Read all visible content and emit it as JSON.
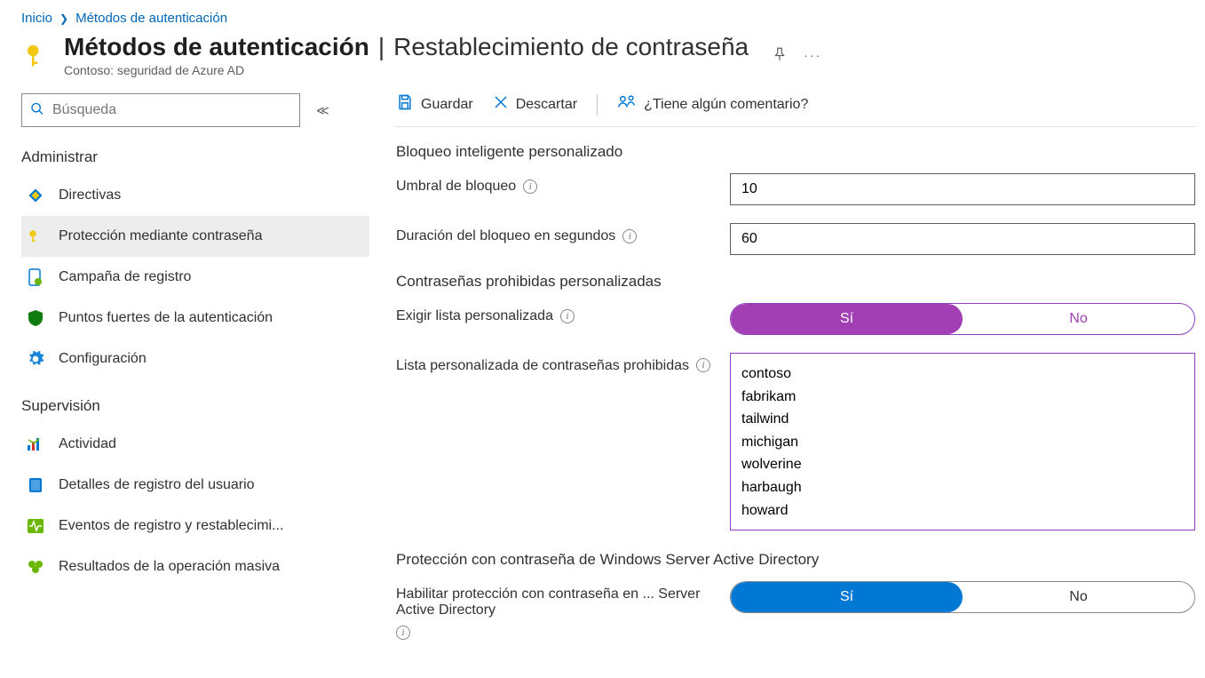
{
  "breadcrumb": {
    "home": "Inicio",
    "current": "Métodos de autenticación"
  },
  "title": {
    "main": "Métodos de autenticación",
    "suffix": "Restablecimiento de contraseña",
    "subtitle": "Contoso: seguridad de Azure AD"
  },
  "search": {
    "placeholder": "Búsqueda"
  },
  "nav": {
    "group1_heading": "Administrar",
    "group1": [
      {
        "label": "Directivas",
        "icon": "policy",
        "active": false
      },
      {
        "label": "Protección mediante contraseña",
        "icon": "key",
        "active": true
      },
      {
        "label": "Campaña de registro",
        "icon": "phone",
        "active": false
      },
      {
        "label": "Puntos fuertes de la autenticación",
        "icon": "shield",
        "active": false
      },
      {
        "label": "Configuración",
        "icon": "gear",
        "active": false
      }
    ],
    "group2_heading": "Supervisión",
    "group2": [
      {
        "label": "Actividad",
        "icon": "chart",
        "active": false
      },
      {
        "label": "Detalles de registro del usuario",
        "icon": "book",
        "active": false
      },
      {
        "label": "Eventos de registro y restablecimi...",
        "icon": "pulse",
        "active": false
      },
      {
        "label": "Resultados de la operación masiva",
        "icon": "bulk",
        "active": false
      }
    ]
  },
  "commands": {
    "save": "Guardar",
    "discard": "Descartar",
    "feedback": "¿Tiene algún comentario?"
  },
  "form": {
    "section1": "Bloqueo inteligente personalizado",
    "lockout_threshold_label": "Umbral de bloqueo",
    "lockout_threshold_value": "10",
    "lockout_duration_label": "Duración del bloqueo en segundos",
    "lockout_duration_value": "60",
    "section2": "Contraseñas prohibidas personalizadas",
    "enforce_list_label": "Exigir lista personalizada",
    "custom_list_label": "Lista personalizada de contraseñas prohibidas",
    "custom_list_value": "contoso\nfabrikam\ntailwind\nmichigan\nwolverine\nharbaugh\nhoward",
    "section3": "Protección con contraseña de Windows Server Active Directory",
    "enable_onprem_label": "Habilitar protección con contraseña en ... Server Active Directory",
    "yes": "Sí",
    "no": "No"
  }
}
